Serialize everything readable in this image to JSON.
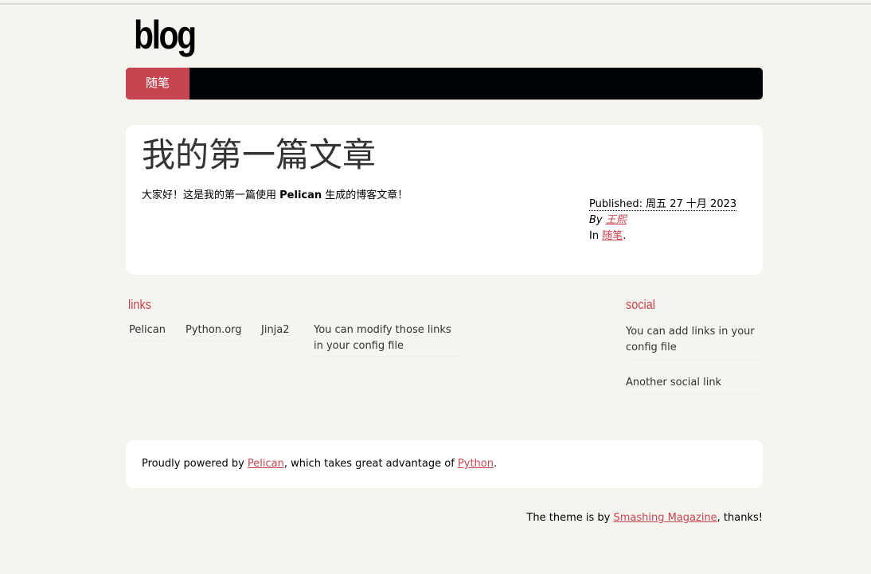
{
  "site": {
    "title": "blog"
  },
  "nav": {
    "items": [
      {
        "label": "随笔"
      }
    ]
  },
  "article": {
    "title": "我的第一篇文章",
    "body_before": "大家好！这是我的第一篇使用 ",
    "body_bold": "Pelican",
    "body_after": " 生成的博客文章！",
    "published_label": "Published:",
    "published_date": "周五 27 十月 2023",
    "by_label": "By",
    "author": "王熙",
    "in_label": "In",
    "category": "随笔",
    "category_suffix": "."
  },
  "links": {
    "title": "links",
    "items": [
      "Pelican",
      "Python.org",
      "Jinja2",
      "You can modify those links in your config file"
    ]
  },
  "social": {
    "title": "social",
    "items": [
      "You can add links in your config file",
      "Another social link"
    ]
  },
  "footer": {
    "powered_prefix": "Proudly powered by",
    "powered_link1": "Pelican",
    "powered_middle": ", which takes great advantage of",
    "powered_link2": "Python",
    "powered_suffix": ".",
    "theme_prefix": "The theme is by",
    "theme_link": "Smashing Magazine",
    "theme_suffix": ", thanks!"
  },
  "colors": {
    "accent": "#c74451",
    "nav_bg": "#000305",
    "page_bg": "#f5f4ef"
  }
}
